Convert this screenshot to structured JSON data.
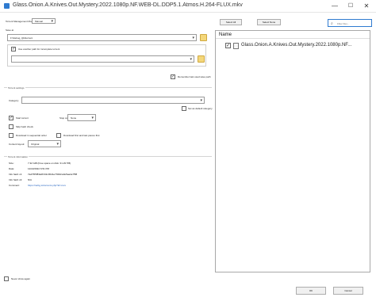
{
  "window": {
    "title": "Glass.Onion.A.Knives.Out.Mystery.2022.1080p.NF.WEB-DL.DDP5.1.Atmos.H.264-FLUX.mkv",
    "minimize": "—",
    "maximize": "☐",
    "close": "✕"
  },
  "left": {
    "torrent_mode_label": "Torrent Management Mode:",
    "torrent_mode_value": "Manual",
    "save_at_label": "Save at",
    "save_path_value": "F:\\Debug_Qbittorrent",
    "use_another_path_label": "Use another path for incomplete torrent",
    "incomplete_path_value": "",
    "remember_last_path_label": "Remember last used save path",
    "torrent_settings_label": "Torrent settings",
    "category_label": "Category:",
    "category_value": "",
    "set_default_category_label": "Set as default category",
    "start_torrent_label": "Start torrent",
    "stop_condition_label": "Stop condition:",
    "stop_condition_value": "None",
    "skip_hash_check_label": "Skip hash check",
    "download_sequential_label": "Download in sequential order",
    "download_first_last_label": "Download first and last pieces first",
    "content_layout_label": "Content layout:",
    "content_layout_value": "Original",
    "torrent_info_label": "Torrent information",
    "info": [
      {
        "key": "Size:",
        "value": "7.32 GiB (Free space on disk: 31.29 TiB)"
      },
      {
        "key": "Date:",
        "value": "12/22/2022 6:51 PM"
      },
      {
        "key": "Info hash v1:",
        "value": "7ad7f05f83a0f1b3c06d1e7b9f2ca0e5aa4e7f58"
      },
      {
        "key": "Info hash v2:",
        "value": "N/A"
      },
      {
        "key": "Comment:",
        "value": "https://rarbg.to/torrents.php?id=xxxx",
        "link": true
      }
    ],
    "never_show_again_label": "Never show again"
  },
  "top": {
    "select_all": "Select All",
    "select_none": "Select None",
    "filter_placeholder": "Filter files..."
  },
  "files": {
    "column_name": "Name",
    "items": [
      {
        "name": "Glass.Onion.A.Knives.Out.Mystery.2022.1080p.NF...",
        "checked": true
      }
    ]
  },
  "bottom": {
    "ok": "OK",
    "cancel": "Cancel"
  }
}
